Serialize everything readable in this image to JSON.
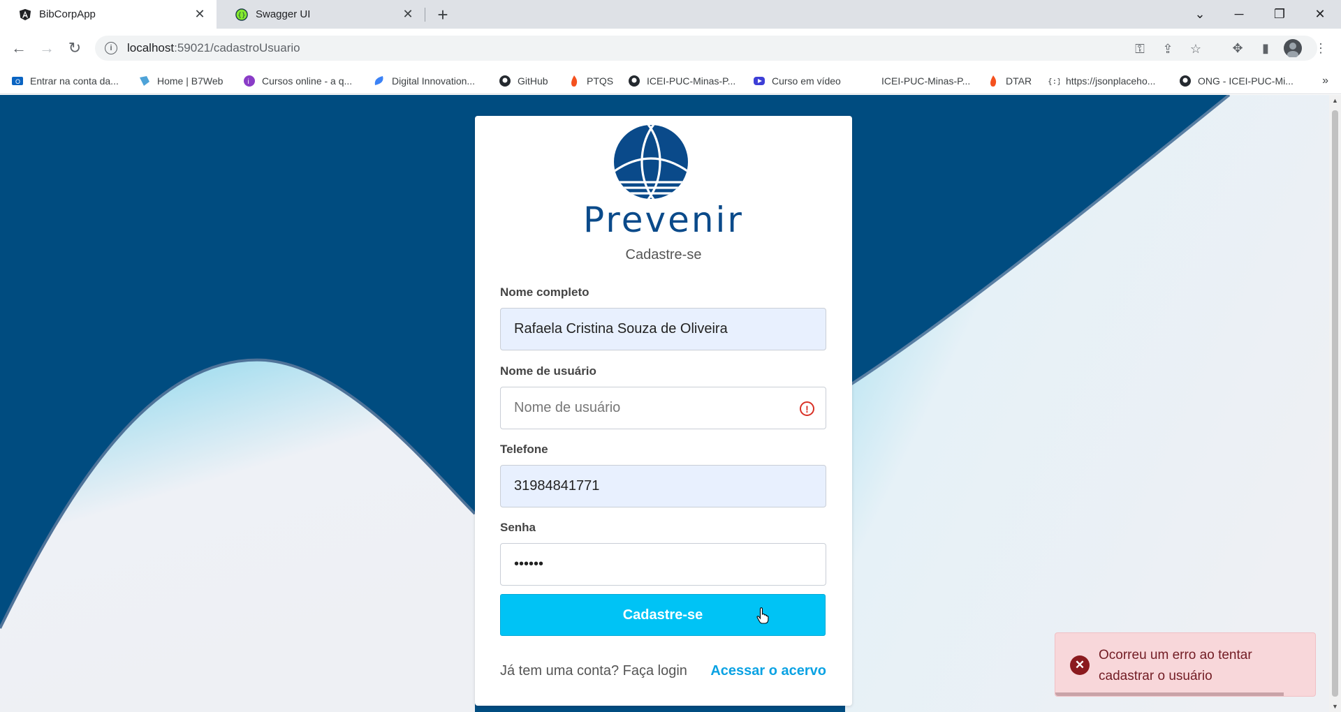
{
  "browser": {
    "tabs": [
      {
        "title": "BibCorpApp",
        "icon": "angular-icon",
        "active": true
      },
      {
        "title": "Swagger UI",
        "icon": "swagger-icon",
        "active": false
      }
    ],
    "url_host": "localhost",
    "url_path": ":59021/cadastroUsuario",
    "bookmarks": [
      {
        "label": "Entrar na conta da...",
        "icon": "outlook-icon"
      },
      {
        "label": "Home | B7Web",
        "icon": "b7web-icon"
      },
      {
        "label": "Cursos online - a q...",
        "icon": "cursos-icon"
      },
      {
        "label": "Digital Innovation...",
        "icon": "dio-icon"
      },
      {
        "label": "GitHub",
        "icon": "github-icon"
      },
      {
        "label": "PTQS",
        "icon": "flame-icon"
      },
      {
        "label": "ICEI-PUC-Minas-P...",
        "icon": "github-icon"
      },
      {
        "label": "Curso em vídeo",
        "icon": "cursoemvideo-icon"
      },
      {
        "label": "ICEI-PUC-Minas-P...",
        "icon": "none"
      },
      {
        "label": "DTAR",
        "icon": "flame-icon"
      },
      {
        "label": "https://jsonplaceho...",
        "icon": "jsonplaceholder-icon"
      },
      {
        "label": "ONG - ICEI-PUC-Mi...",
        "icon": "github-icon"
      }
    ],
    "bookmarks_more": "»"
  },
  "form": {
    "brand": "Prevenir",
    "subtitle": "Cadastre-se",
    "fields": {
      "full_name": {
        "label": "Nome completo",
        "value": "Rafaela Cristina Souza de Oliveira"
      },
      "username": {
        "label": "Nome de usuário",
        "placeholder": "Nome de usuário",
        "value": ""
      },
      "phone": {
        "label": "Telefone",
        "value": "31984841771"
      },
      "password": {
        "label": "Senha",
        "value": "••••••"
      }
    },
    "submit_label": "Cadastre-se",
    "login_prompt": "Já tem uma conta? Faça login",
    "login_link": "Acessar o acervo"
  },
  "toast": {
    "message": "Ocorreu um erro ao tentar cadastrar o usuário",
    "type": "error",
    "progress": 0.88
  },
  "colors": {
    "brand": "#0a4a8a",
    "navy_bg": "#004c80",
    "button": "#00c3f5",
    "link": "#0aa2e3",
    "error": "#d93025"
  }
}
